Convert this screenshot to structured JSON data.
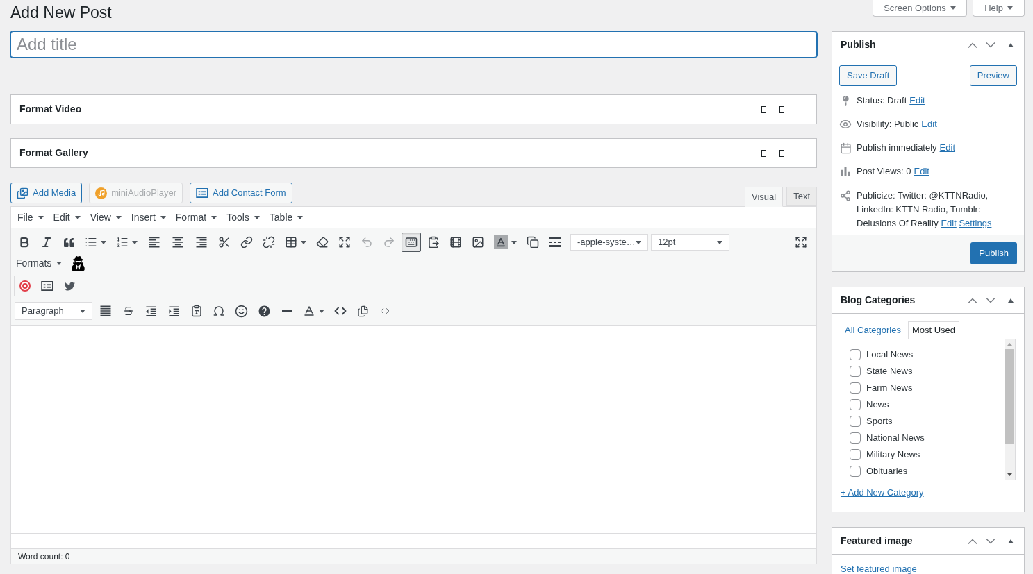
{
  "page": {
    "title": "Add New Post"
  },
  "header_buttons": [
    {
      "label": "Screen Options"
    },
    {
      "label": "Help"
    }
  ],
  "title_field": {
    "placeholder": "Add title"
  },
  "format_boxes": [
    {
      "title": "Format Video"
    },
    {
      "title": "Format Gallery"
    }
  ],
  "media_buttons": [
    {
      "kind": "media",
      "label": "Add Media",
      "disabled": false
    },
    {
      "kind": "audio",
      "label": "miniAudioPlayer",
      "disabled": true
    },
    {
      "kind": "form",
      "label": "Add Contact Form",
      "disabled": false
    }
  ],
  "editor_tabs": [
    {
      "label": "Visual",
      "selected": true
    },
    {
      "label": "Text",
      "selected": false
    }
  ],
  "menu_bar": [
    "File",
    "Edit",
    "View",
    "Insert",
    "Format",
    "Tools",
    "Table"
  ],
  "toolbar": {
    "undo": {
      "disabled": true
    },
    "redo": {
      "disabled": true
    },
    "toolbar_toggle": {
      "pressed": true
    },
    "font_family": {
      "value": "-apple-syste…"
    },
    "font_size": {
      "value": "12pt"
    },
    "formats": {
      "label": "Formats"
    },
    "block_format": {
      "value": "Paragraph"
    }
  },
  "status_bar": {
    "word_count": "Word count: 0"
  },
  "publish_box": {
    "title": "Publish",
    "save_draft": "Save Draft",
    "preview": "Preview",
    "rows": [
      {
        "kind": "status",
        "text": "Status: Draft",
        "links": [
          "Edit"
        ]
      },
      {
        "kind": "visibility",
        "text": "Visibility: Public",
        "links": [
          "Edit"
        ]
      },
      {
        "kind": "schedule",
        "text": "Publish immediately",
        "links": [
          "Edit"
        ]
      },
      {
        "kind": "views",
        "text": "Post Views: 0",
        "links": [
          "Edit"
        ]
      },
      {
        "kind": "publicize",
        "text": "Publicize: Twitter: @KTTNRadio, LinkedIn: KTTN Radio, Tumblr: Delusions Of Reality",
        "links": [
          "Edit",
          "Settings"
        ]
      }
    ],
    "publish_button": "Publish"
  },
  "categories_box": {
    "title": "Blog Categories",
    "tabs": [
      {
        "label": "All Categories",
        "selected": false
      },
      {
        "label": "Most Used",
        "selected": true
      }
    ],
    "items": [
      {
        "label": "Local News",
        "checked": false
      },
      {
        "label": "State News",
        "checked": false
      },
      {
        "label": "Farm News",
        "checked": false
      },
      {
        "label": "News",
        "checked": false
      },
      {
        "label": "Sports",
        "checked": false
      },
      {
        "label": "National News",
        "checked": false
      },
      {
        "label": "Military News",
        "checked": false
      },
      {
        "label": "Obituaries",
        "checked": false
      }
    ],
    "add_link": "+ Add New Category"
  },
  "featured_image_box": {
    "title": "Featured image",
    "link": "Set featured image"
  }
}
